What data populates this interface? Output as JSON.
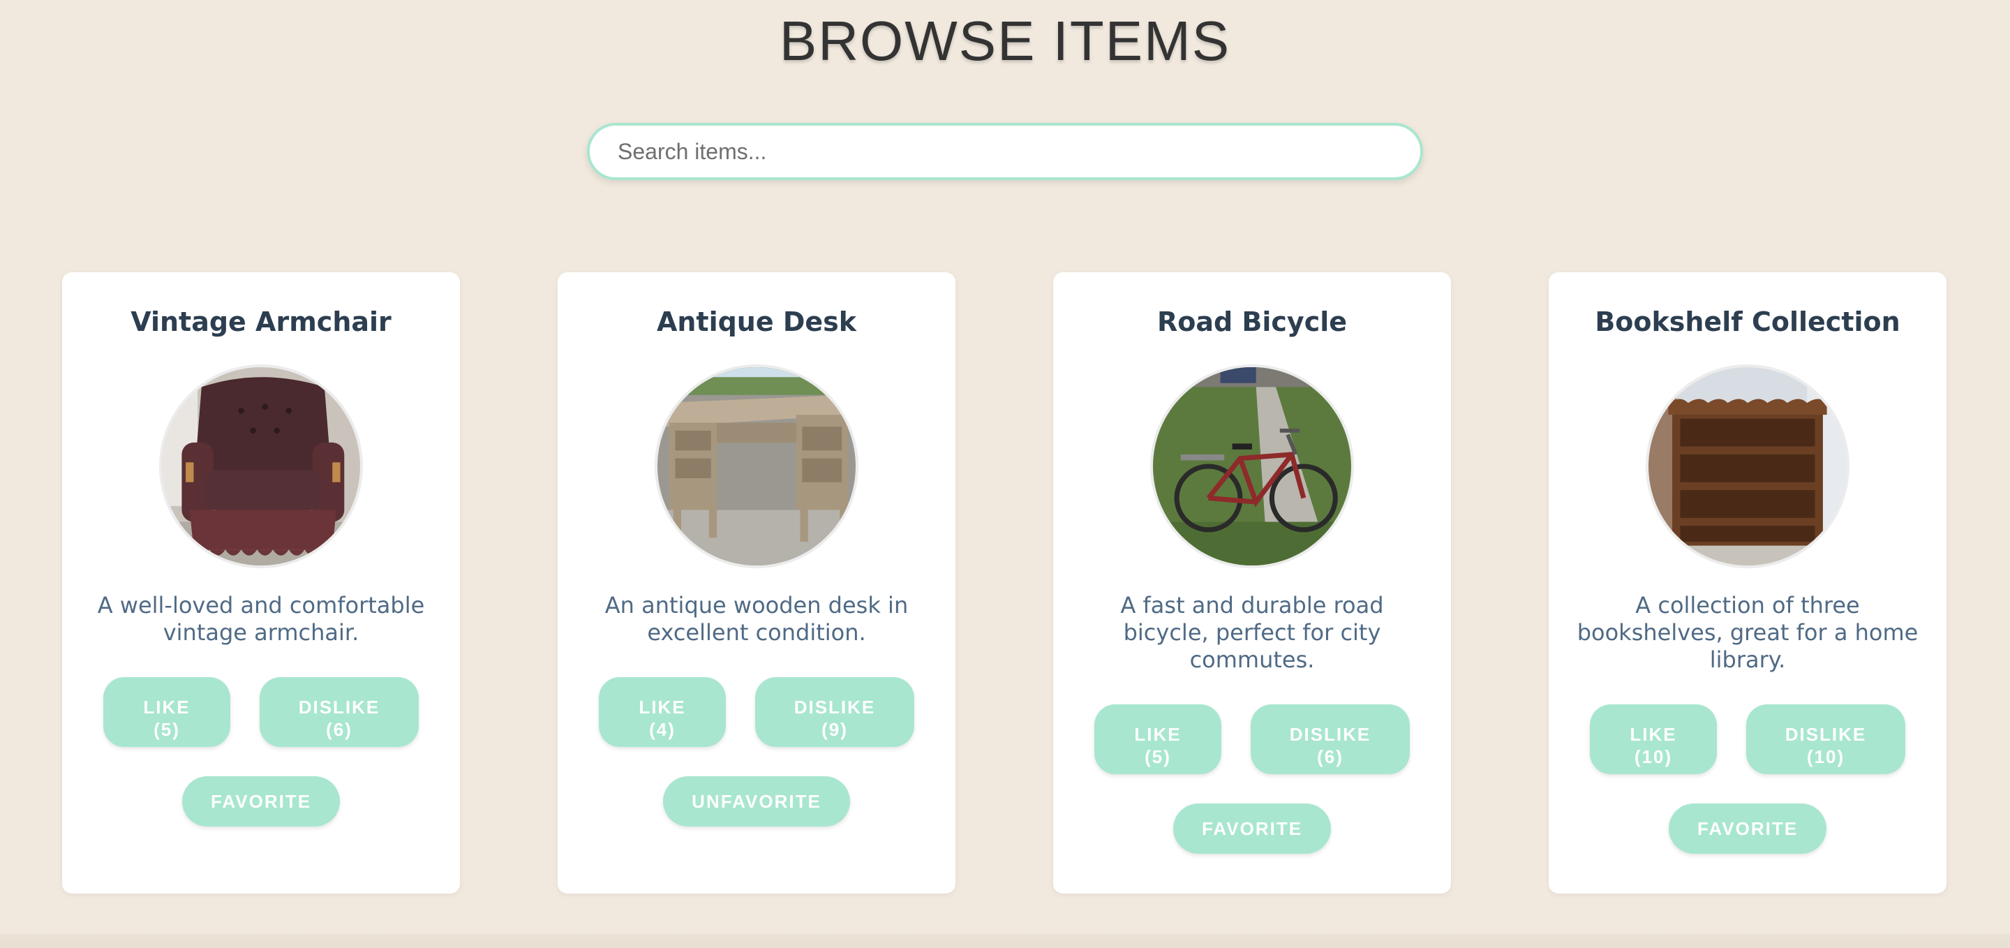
{
  "page": {
    "title": "BROWSE ITEMS",
    "search_placeholder": "Search items..."
  },
  "colors": {
    "background": "#f1e9de",
    "accent": "#a8e6cf",
    "title_text": "#2c3e50",
    "description_text": "#4f6a85"
  },
  "items": [
    {
      "title": "Vintage Armchair",
      "image_icon": "armchair-photo",
      "description": "A well-loved and comfortable vintage armchair.",
      "like_label": "LIKE",
      "like_count": "(5)",
      "dislike_label": "DISLIKE",
      "dislike_count": "(6)",
      "favorite_label": "FAVORITE"
    },
    {
      "title": "Antique Desk",
      "image_icon": "desk-photo",
      "description": "An antique wooden desk in excellent condition.",
      "like_label": "LIKE",
      "like_count": "(4)",
      "dislike_label": "DISLIKE",
      "dislike_count": "(9)",
      "favorite_label": "UNFAVORITE"
    },
    {
      "title": "Road Bicycle",
      "image_icon": "bicycle-photo",
      "description": "A fast and durable road bicycle, perfect for city commutes.",
      "like_label": "LIKE",
      "like_count": "(5)",
      "dislike_label": "DISLIKE",
      "dislike_count": "(6)",
      "favorite_label": "FAVORITE"
    },
    {
      "title": "Bookshelf Collection",
      "image_icon": "bookshelf-photo",
      "description": "A collection of three bookshelves, great for a home library.",
      "like_label": "LIKE",
      "like_count": "(10)",
      "dislike_label": "DISLIKE",
      "dislike_count": "(10)",
      "favorite_label": "FAVORITE"
    }
  ]
}
